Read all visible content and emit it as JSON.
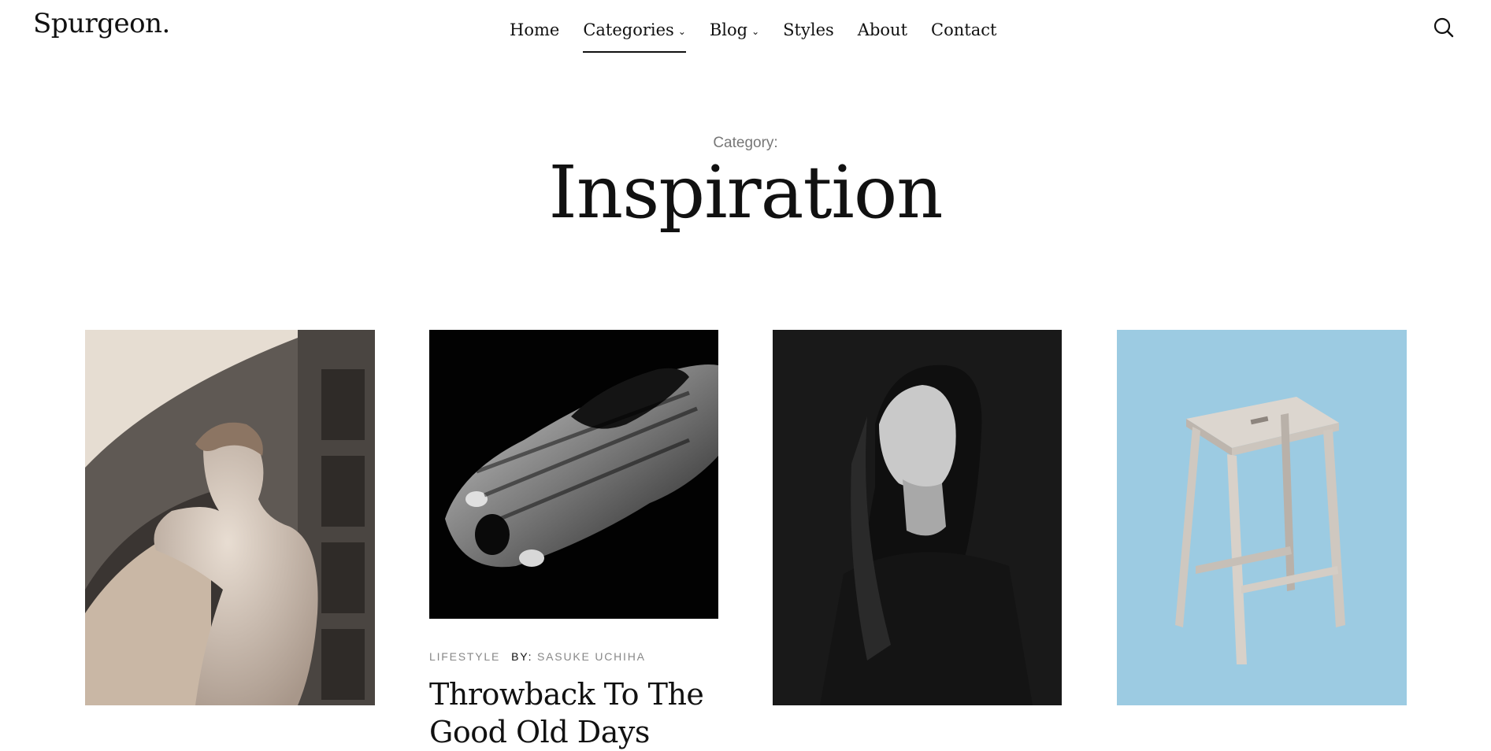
{
  "site": {
    "logo": "Spurgeon."
  },
  "nav": {
    "items": [
      {
        "label": "Home"
      },
      {
        "label": "Categories",
        "caret": "⌄"
      },
      {
        "label": "Blog",
        "caret": "⌄"
      },
      {
        "label": "Styles"
      },
      {
        "label": "About"
      },
      {
        "label": "Contact"
      }
    ],
    "search_icon": "search-icon"
  },
  "archive": {
    "label": "Category:",
    "title": "Inspiration"
  },
  "posts": [
    {
      "image": "statue-of-david-photo"
    },
    {
      "image": "black-and-white-beetle-car-photo",
      "category": "LIFESTYLE",
      "by_label": "BY:",
      "author": "SASUKE UCHIHA",
      "title": "Throwback To The Good Old Days"
    },
    {
      "image": "woman-portrait-photo"
    },
    {
      "image": "wooden-stool-on-blue-photo"
    }
  ],
  "colors": {
    "text": "#111111",
    "muted": "#888888",
    "stool_bg": "#9ccbe2"
  }
}
